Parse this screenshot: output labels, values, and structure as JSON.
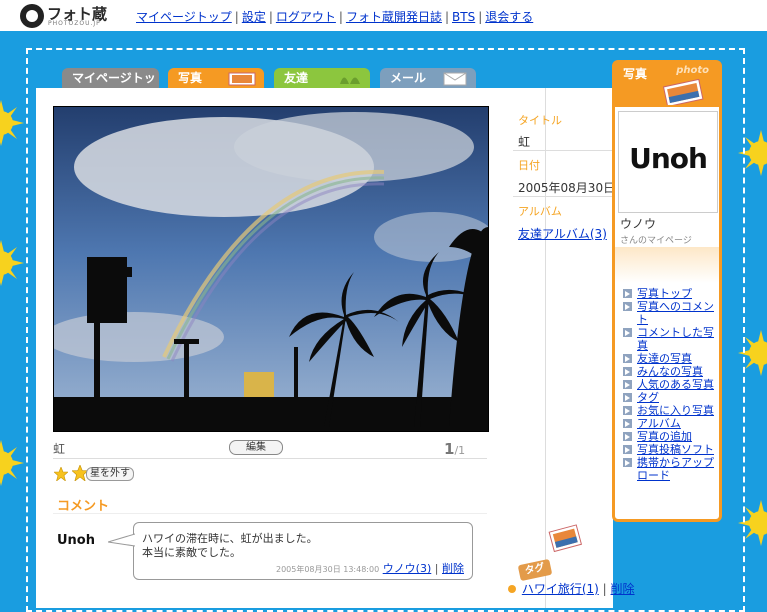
{
  "logo": {
    "name": "フォト蔵",
    "sub": "PHOTOZOU.JP"
  },
  "topnav": [
    "マイページトップ",
    "設定",
    "ログアウト",
    "フォト蔵開発日誌",
    "BTS",
    "退会する"
  ],
  "tabs": [
    "マイページトップ",
    "写真",
    "友達",
    "メール"
  ],
  "photo": {
    "title": "虹",
    "edit_label": "編集",
    "page_current": "1",
    "page_total": "/1",
    "unstar_label": "星を外す"
  },
  "meta": {
    "title_label": "タイトル",
    "title_value": "虹",
    "date_label": "日付",
    "date_value": "2005年08月30日",
    "album_label": "アルバム",
    "album_value": "友達アルバム(3)"
  },
  "comments": {
    "heading": "コメント",
    "avatar": "Unoh",
    "text_line1": "ハワイの滞在時に、虹が出ました。",
    "text_line2": "本当に素敵でした。",
    "timestamp": "2005年08月30日 13:48:00",
    "author": "ウノウ(3)",
    "delete": "削除"
  },
  "tags": {
    "label": "タグ",
    "item": "ハワイ旅行(1)",
    "delete": "削除"
  },
  "card": {
    "header_jp": "写真",
    "header_en": "photo",
    "avatar_text": "Unoh",
    "user_name": "ウノウ",
    "user_sub": "さんのマイページ",
    "links": [
      "写真トップ",
      "写真へのコメント",
      "コメントした写真",
      "友達の写真",
      "みんなの写真",
      "人気のある写真",
      "タグ",
      "お気に入り写真",
      "アルバム",
      "写真の追加",
      "写真投稿ソフト",
      "携帯からアップロード"
    ]
  },
  "colors": {
    "background": "#1a9de0",
    "accent": "#f59a23",
    "link": "#0033cc"
  }
}
